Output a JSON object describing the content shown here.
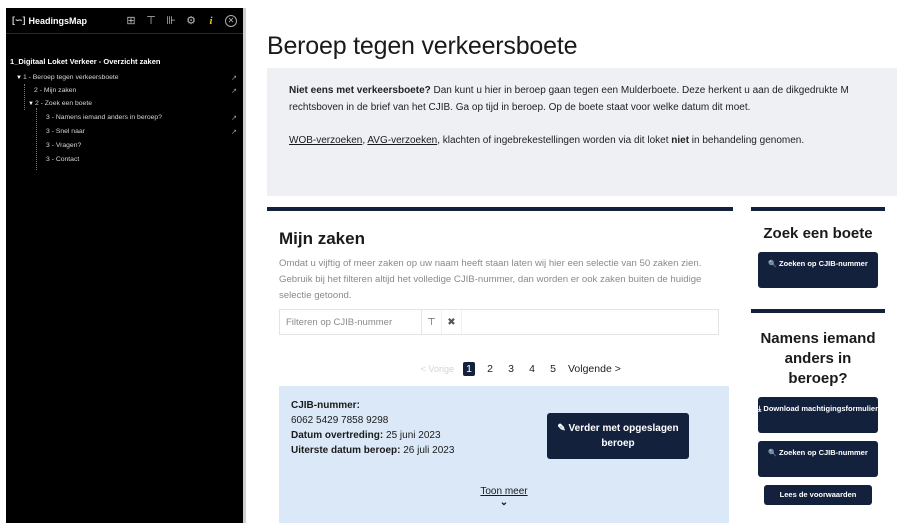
{
  "headingsmap": {
    "app_title": "HeadingsMap",
    "logo_glyph": "[∽]",
    "tools": [
      "⊞",
      "⊤",
      "⊪",
      "⚙",
      "i",
      "✕"
    ],
    "document_title": "1_Digitaal Loket Verkeer - Overzicht zaken",
    "tree": [
      {
        "level": 1,
        "label": "1 - Beroep tegen verkeersboete",
        "expanded": true
      },
      {
        "level": 2,
        "label": "2 - Mijn zaken"
      },
      {
        "level": 2,
        "label": "2 - Zoek een boete",
        "expanded": true
      },
      {
        "level": 3,
        "label": "3 - Namens iemand anders in beroep?"
      },
      {
        "level": 3,
        "label": "3 - Snel naar"
      },
      {
        "level": 3,
        "label": "3 - Vragen?"
      },
      {
        "level": 3,
        "label": "3 - Contact"
      }
    ]
  },
  "page": {
    "title": "Beroep tegen verkeersboete",
    "notice": {
      "lead_bold": "Niet eens met verkeersboete?",
      "lead_text": " Dan kunt u hier in beroep gaan tegen een Mulderboete. Deze herkent u aan de dikgedrukte M rechtsboven in de brief van het CJIB. Ga op tijd in beroep. Op de boete staat voor welke datum dit moet.",
      "link1": "WOB-verzoeken",
      "sep": ", ",
      "link2": "AVG-verzoeken",
      "mid_text": ", klachten of ingebrekestellingen worden via dit loket ",
      "niet": "niet",
      "end_text": " in behandeling genomen."
    }
  },
  "mijn_zaken": {
    "title": "Mijn zaken",
    "description": "Omdat u vijftig of meer zaken op uw naam heeft staan laten wij hier een selectie van 50 zaken zien. Gebruik bij het filteren altijd het volledige CJIB-nummer, dan worden er ook zaken buiten de huidige selectie getoond.",
    "filter_placeholder": "Filteren op CJIB-nummer",
    "filter_icon": "⊤",
    "clear_icon": "✖",
    "pagination": {
      "prev": "< Vorige",
      "pages": [
        "1",
        "2",
        "3",
        "4",
        "5"
      ],
      "active": "1",
      "next": "Volgende >"
    },
    "case": {
      "cjib_label": "CJIB-nummer:",
      "cjib_number": "6062 5429 7858 9298",
      "datum_label": "Datum overtreding:",
      "datum_value": " 25 juni 2023",
      "uiterste_label": "Uiterste datum beroep:",
      "uiterste_value": " 26 juli 2023",
      "button_icon": "✎",
      "button_label": " Verder met opgeslagen beroep",
      "toon_meer": "Toon meer",
      "chevron": "⌄"
    }
  },
  "sidebar": {
    "zoek": {
      "title": "Zoek een boete",
      "button_icon": "🔍",
      "button_label": " Zoeken op CJIB-nummer"
    },
    "namens": {
      "title": "Namens iemand anders in beroep?",
      "download_icon": "⤓",
      "download_label": " Download machtigingsformulier",
      "zoek_icon": "🔍",
      "zoek_label": " Zoeken op CJIB-nummer",
      "lees_label": "Lees de voorwaarden"
    }
  },
  "colors": {
    "navy": "#14213d",
    "notice_bg": "#eef0f4",
    "case_bg": "#dbe8f7",
    "panel_bg": "#000000"
  }
}
